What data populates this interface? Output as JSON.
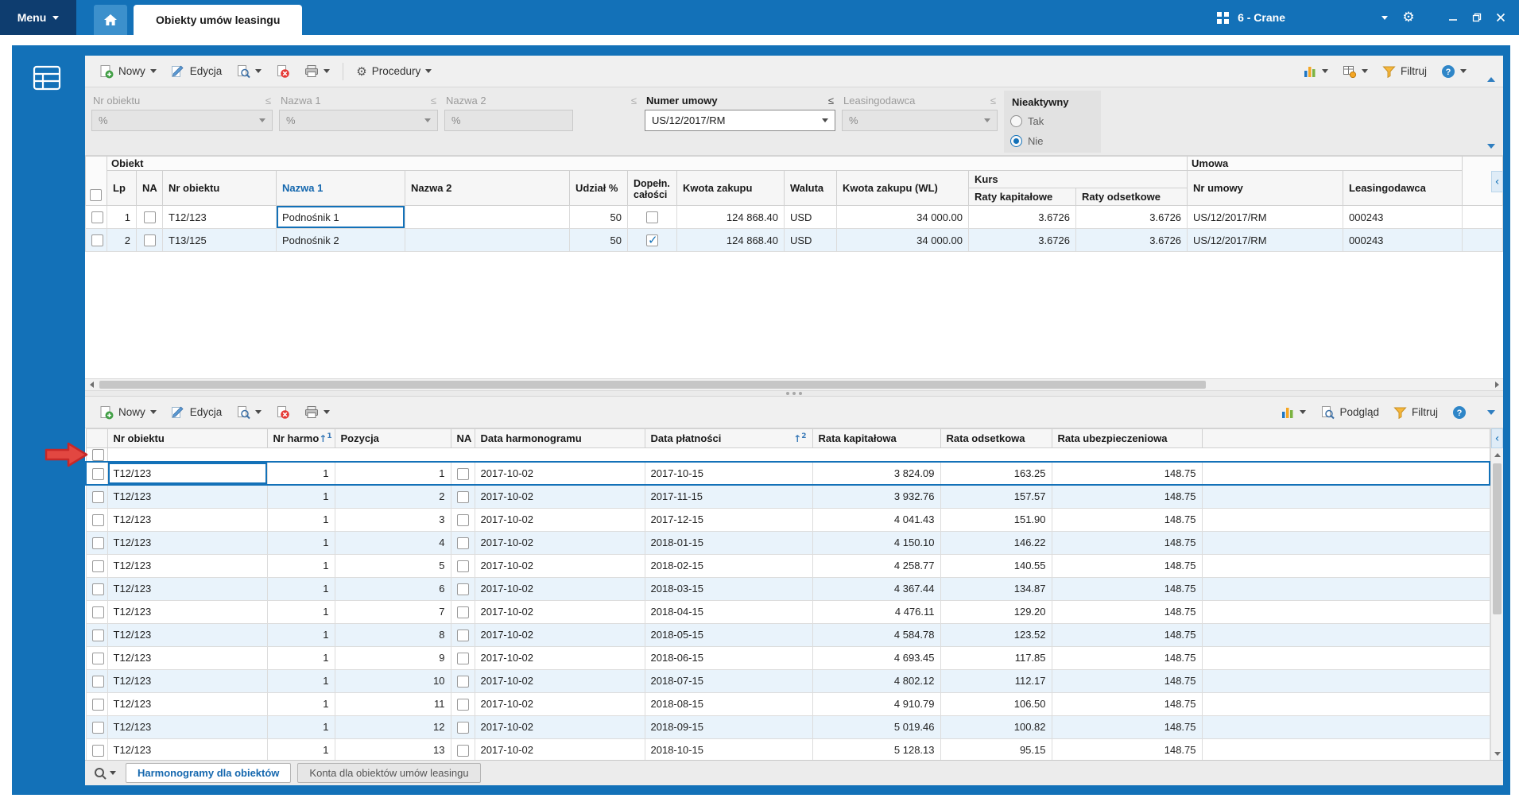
{
  "titlebar": {
    "menu": "Menu",
    "tab": "Obiekty umów leasingu",
    "workspace": "6 - Crane"
  },
  "toolbar_upper": {
    "new": "Nowy",
    "edit": "Edycja",
    "procedures": "Procedury",
    "filter": "Filtruj",
    "help": "?"
  },
  "toolbar_lower": {
    "new": "Nowy",
    "edit": "Edycja",
    "preview": "Podgląd",
    "filter": "Filtruj",
    "help": "?"
  },
  "filters": {
    "fields": [
      {
        "label": "Nr obiektu",
        "op": "≤",
        "value": "%"
      },
      {
        "label": "Nazwa 1",
        "op": "≤",
        "value": "%"
      },
      {
        "label": "Nazwa 2",
        "op": "≤",
        "value": "%"
      },
      {
        "label": "Numer umowy",
        "op": "≤",
        "value": "US/12/2017/RM"
      },
      {
        "label": "Leasingodawca",
        "op": "≤",
        "value": "%"
      }
    ],
    "inactive": {
      "label": "Nieaktywny",
      "yes": "Tak",
      "no": "Nie"
    }
  },
  "upper_grid": {
    "groups": {
      "obiekt": "Obiekt",
      "umowa": "Umowa",
      "kurs": "Kurs"
    },
    "columns": {
      "lp": "Lp",
      "na": "NA",
      "nr": "Nr obiektu",
      "nazwa1": "Nazwa 1",
      "nazwa2": "Nazwa 2",
      "udzial": "Udział %",
      "dopeln": "Dopełn. całości",
      "kwota": "Kwota zakupu",
      "waluta": "Waluta",
      "kwota_wl": "Kwota zakupu (WL)",
      "raty_kap": "Raty kapitałowe",
      "raty_ods": "Raty odsetkowe",
      "umowa": "Nr umowy",
      "leasingodawca": "Leasingodawca"
    },
    "rows": [
      {
        "sel": false,
        "lp": "1",
        "na": false,
        "nr": "T12/123",
        "nazwa1": "Podnośnik 1",
        "nazwa2": "",
        "udzial": "50",
        "dopeln": false,
        "kwota": "124 868.40",
        "waluta": "USD",
        "kwota_wl": "34 000.00",
        "raty_kap": "3.6726",
        "raty_ods": "3.6726",
        "umowa": "US/12/2017/RM",
        "leasingodawca": "000243"
      },
      {
        "sel": false,
        "lp": "2",
        "na": false,
        "nr": "T13/125",
        "nazwa1": "Podnośnik 2",
        "nazwa2": "",
        "udzial": "50",
        "dopeln": true,
        "kwota": "124 868.40",
        "waluta": "USD",
        "kwota_wl": "34 000.00",
        "raty_kap": "3.6726",
        "raty_ods": "3.6726",
        "umowa": "US/12/2017/RM",
        "leasingodawca": "000243"
      }
    ]
  },
  "lower_grid": {
    "columns": {
      "nr": "Nr obiektu",
      "harm": "Nr harmo",
      "poz": "Pozycja",
      "na": "NA",
      "data_h": "Data harmonogramu",
      "data_p": "Data płatności",
      "kap": "Rata kapitałowa",
      "ods": "Rata odsetkowa",
      "ubez": "Rata ubezpieczeniowa"
    },
    "sort1": "1",
    "sort2": "2",
    "rows": [
      {
        "sel": false,
        "nr": "T12/123",
        "harm": "1",
        "poz": "1",
        "na": false,
        "data_h": "2017-10-02",
        "data_p": "2017-10-15",
        "kap": "3 824.09",
        "ods": "163.25",
        "ubez": "148.75"
      },
      {
        "sel": false,
        "nr": "T12/123",
        "harm": "1",
        "poz": "2",
        "na": false,
        "data_h": "2017-10-02",
        "data_p": "2017-11-15",
        "kap": "3 932.76",
        "ods": "157.57",
        "ubez": "148.75"
      },
      {
        "sel": false,
        "nr": "T12/123",
        "harm": "1",
        "poz": "3",
        "na": false,
        "data_h": "2017-10-02",
        "data_p": "2017-12-15",
        "kap": "4 041.43",
        "ods": "151.90",
        "ubez": "148.75"
      },
      {
        "sel": false,
        "nr": "T12/123",
        "harm": "1",
        "poz": "4",
        "na": false,
        "data_h": "2017-10-02",
        "data_p": "2018-01-15",
        "kap": "4 150.10",
        "ods": "146.22",
        "ubez": "148.75"
      },
      {
        "sel": false,
        "nr": "T12/123",
        "harm": "1",
        "poz": "5",
        "na": false,
        "data_h": "2017-10-02",
        "data_p": "2018-02-15",
        "kap": "4 258.77",
        "ods": "140.55",
        "ubez": "148.75"
      },
      {
        "sel": false,
        "nr": "T12/123",
        "harm": "1",
        "poz": "6",
        "na": false,
        "data_h": "2017-10-02",
        "data_p": "2018-03-15",
        "kap": "4 367.44",
        "ods": "134.87",
        "ubez": "148.75"
      },
      {
        "sel": false,
        "nr": "T12/123",
        "harm": "1",
        "poz": "7",
        "na": false,
        "data_h": "2017-10-02",
        "data_p": "2018-04-15",
        "kap": "4 476.11",
        "ods": "129.20",
        "ubez": "148.75"
      },
      {
        "sel": false,
        "nr": "T12/123",
        "harm": "1",
        "poz": "8",
        "na": false,
        "data_h": "2017-10-02",
        "data_p": "2018-05-15",
        "kap": "4 584.78",
        "ods": "123.52",
        "ubez": "148.75"
      },
      {
        "sel": false,
        "nr": "T12/123",
        "harm": "1",
        "poz": "9",
        "na": false,
        "data_h": "2017-10-02",
        "data_p": "2018-06-15",
        "kap": "4 693.45",
        "ods": "117.85",
        "ubez": "148.75"
      },
      {
        "sel": false,
        "nr": "T12/123",
        "harm": "1",
        "poz": "10",
        "na": false,
        "data_h": "2017-10-02",
        "data_p": "2018-07-15",
        "kap": "4 802.12",
        "ods": "112.17",
        "ubez": "148.75"
      },
      {
        "sel": false,
        "nr": "T12/123",
        "harm": "1",
        "poz": "11",
        "na": false,
        "data_h": "2017-10-02",
        "data_p": "2018-08-15",
        "kap": "4 910.79",
        "ods": "106.50",
        "ubez": "148.75"
      },
      {
        "sel": false,
        "nr": "T12/123",
        "harm": "1",
        "poz": "12",
        "na": false,
        "data_h": "2017-10-02",
        "data_p": "2018-09-15",
        "kap": "5 019.46",
        "ods": "100.82",
        "ubez": "148.75"
      },
      {
        "sel": false,
        "nr": "T12/123",
        "harm": "1",
        "poz": "13",
        "na": false,
        "data_h": "2017-10-02",
        "data_p": "2018-10-15",
        "kap": "5 128.13",
        "ods": "95.15",
        "ubez": "148.75"
      }
    ]
  },
  "footer": {
    "tabs": [
      "Harmonogramy dla obiektów",
      "Konta dla obiektów umów leasingu"
    ]
  }
}
